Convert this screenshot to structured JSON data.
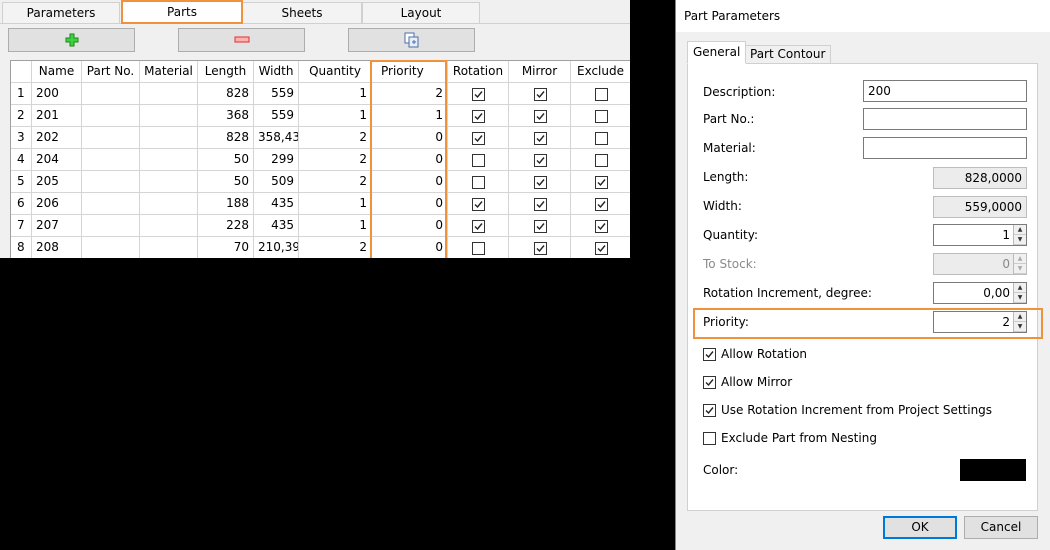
{
  "main_tabs": [
    "Parameters",
    "Parts",
    "Sheets",
    "Layout"
  ],
  "toolbar": {
    "add_icon": "plus-icon",
    "remove_icon": "minus-icon",
    "copy_icon": "copy-icon"
  },
  "table": {
    "columns": [
      "",
      "Name",
      "Part No.",
      "Material",
      "Length",
      "Width",
      "Quantity",
      "Priority",
      "Rotation",
      "Mirror",
      "Exclude"
    ],
    "rows": [
      {
        "n": "1",
        "name": "200",
        "partno": "",
        "material": "",
        "length": "828",
        "width": "559",
        "quantity": "1",
        "priority": "2",
        "rotation": true,
        "mirror": true,
        "exclude": false
      },
      {
        "n": "2",
        "name": "201",
        "partno": "",
        "material": "",
        "length": "368",
        "width": "559",
        "quantity": "1",
        "priority": "1",
        "rotation": true,
        "mirror": true,
        "exclude": false
      },
      {
        "n": "3",
        "name": "202",
        "partno": "",
        "material": "",
        "length": "828",
        "width": "358,43",
        "quantity": "2",
        "priority": "0",
        "rotation": true,
        "mirror": true,
        "exclude": false
      },
      {
        "n": "4",
        "name": "204",
        "partno": "",
        "material": "",
        "length": "50",
        "width": "299",
        "quantity": "2",
        "priority": "0",
        "rotation": false,
        "mirror": true,
        "exclude": false
      },
      {
        "n": "5",
        "name": "205",
        "partno": "",
        "material": "",
        "length": "50",
        "width": "509",
        "quantity": "2",
        "priority": "0",
        "rotation": false,
        "mirror": true,
        "exclude": true
      },
      {
        "n": "6",
        "name": "206",
        "partno": "",
        "material": "",
        "length": "188",
        "width": "435",
        "quantity": "1",
        "priority": "0",
        "rotation": true,
        "mirror": true,
        "exclude": true
      },
      {
        "n": "7",
        "name": "207",
        "partno": "",
        "material": "",
        "length": "228",
        "width": "435",
        "quantity": "1",
        "priority": "0",
        "rotation": true,
        "mirror": true,
        "exclude": true
      },
      {
        "n": "8",
        "name": "208",
        "partno": "",
        "material": "",
        "length": "70",
        "width": "210,39",
        "quantity": "2",
        "priority": "0",
        "rotation": false,
        "mirror": true,
        "exclude": true
      }
    ]
  },
  "dialog": {
    "title": "Part Parameters",
    "tabs": [
      "General",
      "Part Contour"
    ],
    "description_label": "Description:",
    "description_value": "200",
    "partno_label": "Part No.:",
    "partno_value": "",
    "material_label": "Material:",
    "material_value": "",
    "length_label": "Length:",
    "length_value": "828,0000",
    "width_label": "Width:",
    "width_value": "559,0000",
    "quantity_label": "Quantity:",
    "quantity_value": "1",
    "tostock_label": "To Stock:",
    "tostock_value": "0",
    "rotinc_label": "Rotation Increment, degree:",
    "rotinc_value": "0,00",
    "priority_label": "Priority:",
    "priority_value": "2",
    "allow_rotation_label": "Allow Rotation",
    "allow_rotation": true,
    "allow_mirror_label": "Allow Mirror",
    "allow_mirror": true,
    "use_rotinc_label": "Use Rotation Increment from Project Settings",
    "use_rotinc": true,
    "exclude_label": "Exclude Part from Nesting",
    "exclude": false,
    "color_label": "Color:",
    "color_value": "#000000",
    "ok_label": "OK",
    "cancel_label": "Cancel"
  },
  "highlight_color": "#f0923b"
}
